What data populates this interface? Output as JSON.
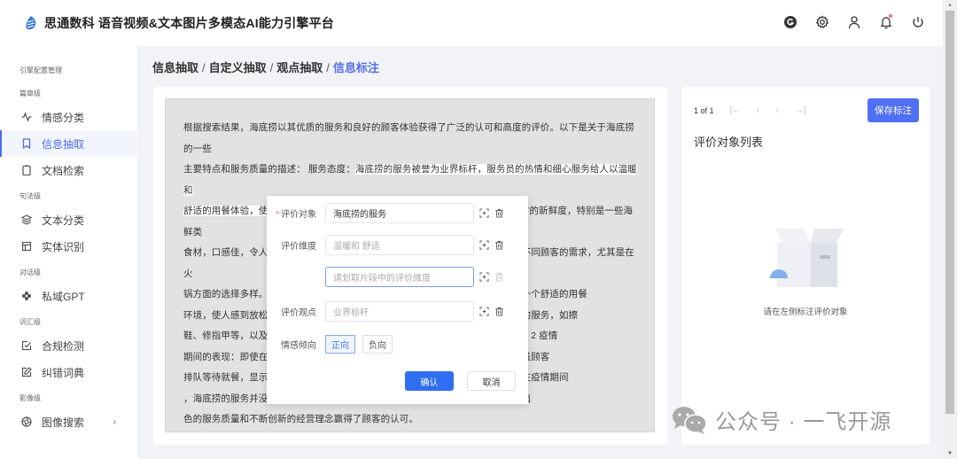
{
  "header": {
    "logo_icon": "app-logo-icon",
    "title": "思通数科 语音视频&文本图片多模态AI能力引擎平台",
    "icons": [
      "github-icon",
      "gear-icon",
      "user-icon",
      "bell-icon",
      "power-icon"
    ],
    "notification_dot_color": "#f56c6c"
  },
  "sidebar": {
    "top_label": "引擎配置管理",
    "groups": [
      {
        "label": "篇章级",
        "items": [
          {
            "label": "情感分类",
            "icon": "activity-icon"
          },
          {
            "label": "信息抽取",
            "icon": "bookmark-icon",
            "active": true
          },
          {
            "label": "文档检索",
            "icon": "clipboard-icon"
          }
        ]
      },
      {
        "label": "句法级",
        "items": [
          {
            "label": "文本分类",
            "icon": "layers-icon"
          },
          {
            "label": "实体识别",
            "icon": "layout-icon"
          }
        ]
      },
      {
        "label": "对话级",
        "items": [
          {
            "label": "私域GPT",
            "icon": "openai-icon"
          }
        ]
      },
      {
        "label": "词汇级",
        "items": [
          {
            "label": "合规检测",
            "icon": "check-square-icon"
          },
          {
            "label": "纠错词典",
            "icon": "edit-icon"
          }
        ]
      },
      {
        "label": "影像级",
        "items": [
          {
            "label": "图像搜索",
            "icon": "aperture-icon",
            "has_submenu": true
          }
        ]
      }
    ]
  },
  "breadcrumb": {
    "items": [
      "信息抽取",
      "自定义抽取",
      "观点抽取"
    ],
    "current": "信息标注",
    "separator": "/"
  },
  "document": {
    "lines": [
      "根据搜索结果，海底捞以其优质的服务和良好的顾客体验获得了广泛的认可和高度的评价。以下是关于海底捞的一些",
      [
        "主要特点和服务质量的描述： 服务态度：",
        "海底捞的服务被誉为业界标杆，服务员的热情和细心服务给人以温暖和"
      ],
      [
        "",
        "舒适的用餐体验，使得顾客感觉像是家人在照顾自己。",
        "1 食材新鲜：海底捞注重食材的新鲜度，特别是一些海鲜类"
      ],
      "食材，口感佳，令人印象深刻。菜品丰富：海底捞提供了多样的菜品种类，满足了不同顾客的需求，尤其是在火",
      "锅方面的选择多样。海底捞的就餐环境整洁、舒适，装修风格独特，为顾客营造出一个舒适的用餐",
      "环境，使人感到放松。海底捞为等候的顾客提供了很多贴心的服务，还会提供额外的服务，如擦",
      "鞋、修指甲等，以及为顾客提供免费小吃和饮品，为顾客提供超出顾客预期的服务。2 疫情",
      "期间的表现：即使在疫情期间，海底捞也始终保持着高水平的服务质量，吸引了大量顾客",
      "排队等待就餐，显示出海底捞在顾客中的良好口碑。有顾客在评论中表示，即使是在疫情期间",
      "，海底捞的服务并没有打折扣，仍然保持了一贯的高水准。综上所述，海底捞因其出",
      "色的服务质量和不断创新的经营理念赢得了顾客的认可。"
    ]
  },
  "dialog": {
    "fields": [
      {
        "label": "评价对象",
        "required": true,
        "value": "海底捞的服务",
        "placeholder": ""
      },
      {
        "label": "评价维度",
        "required": false,
        "value": "温暖和 舒适",
        "placeholder": ""
      },
      {
        "label": "",
        "required": false,
        "value": "",
        "placeholder": "请划取片段中的评价维度",
        "focused": true
      },
      {
        "label": "评价观点",
        "required": false,
        "value": "业界标杆",
        "placeholder": ""
      }
    ],
    "field_icons": [
      "select-region-icon",
      "trash-icon"
    ],
    "sentiment_label": "情感倾向",
    "sentiment_options": [
      {
        "label": "正向",
        "selected": true
      },
      {
        "label": "负向",
        "selected": false
      }
    ],
    "confirm_label": "确认",
    "cancel_label": "取消",
    "confirm_color": "#2f6ef0"
  },
  "right_panel": {
    "pager_text": "1 of 1",
    "pager_icons": [
      "first-page-icon",
      "prev-page-icon",
      "next-page-icon",
      "last-page-icon"
    ],
    "save_label": "保存标注",
    "save_color": "#4f6ff5",
    "list_title": "评价对象列表",
    "empty_icon": "empty-box-icon",
    "empty_text": "请在左侧标注评价对象"
  },
  "watermark": {
    "icon": "wechat-icon",
    "text": "公众号 · 一飞开源"
  },
  "colors": {
    "accent": "#4a6cf0",
    "breadcrumb_current": "#5670e6",
    "required": "#f56c6c"
  }
}
